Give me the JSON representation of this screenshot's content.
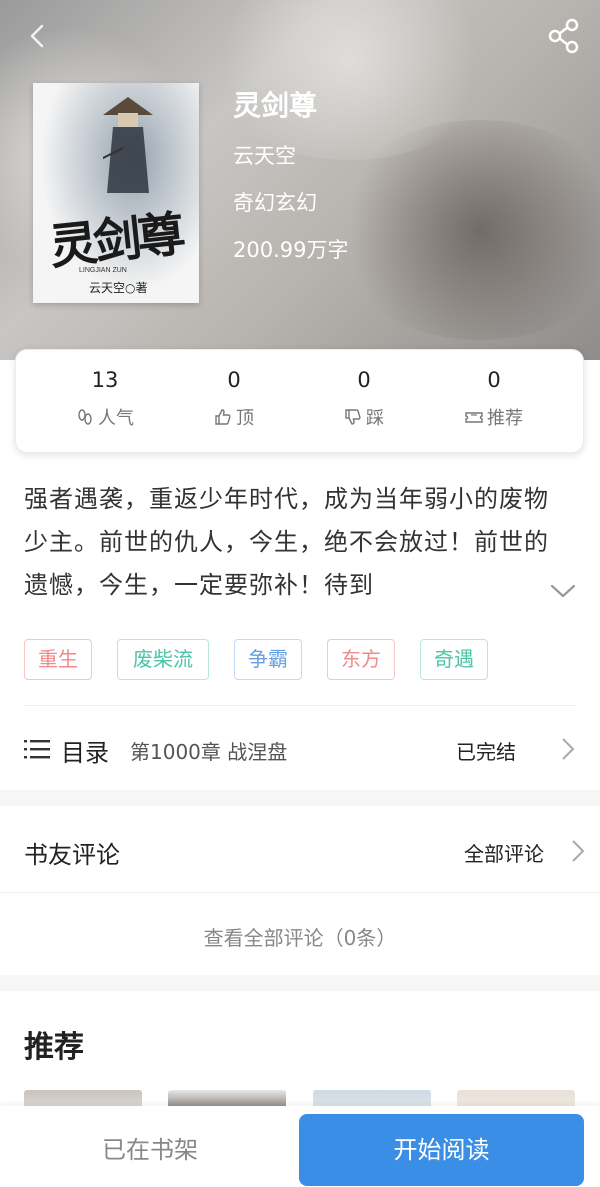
{
  "book": {
    "title": "灵剑尊",
    "author": "云天空",
    "genre": "奇幻玄幻",
    "word_count": "200.99万字",
    "cover": {
      "title_art": "灵剑尊",
      "pinyin": "LINGJIAN ZUN",
      "author_line": "云天空○著"
    }
  },
  "stats": [
    {
      "value": "13",
      "label": "人气",
      "icon": "footprint-icon"
    },
    {
      "value": "0",
      "label": "顶",
      "icon": "thumbs-up-icon"
    },
    {
      "value": "0",
      "label": "踩",
      "icon": "thumbs-down-icon"
    },
    {
      "value": "0",
      "label": "推荐",
      "icon": "ticket-icon"
    }
  ],
  "intro": {
    "text": "强者遇袭，重返少年时代，成为当年弱小的废物少主。前世的仇人，今生，绝不会放过！前世的遗憾，今生，一定要弥补！待到"
  },
  "tags": [
    {
      "label": "重生",
      "color": "#f08a8a"
    },
    {
      "label": "废柴流",
      "color": "#4dc4a8"
    },
    {
      "label": "争霸",
      "color": "#6aa0e0"
    },
    {
      "label": "东方",
      "color": "#f08a8a"
    },
    {
      "label": "奇遇",
      "color": "#4dc4a8"
    }
  ],
  "catalog": {
    "label": "目录",
    "latest_chapter": "第1000章 战涅盘",
    "status": "已完结"
  },
  "comments": {
    "title": "书友评论",
    "all_label": "全部评论",
    "view_all": "查看全部评论（0条）"
  },
  "recommend": {
    "title": "推荐"
  },
  "bottom_bar": {
    "shelf_label": "已在书架",
    "read_label": "开始阅读"
  },
  "colors": {
    "accent": "#3a8ee6"
  }
}
